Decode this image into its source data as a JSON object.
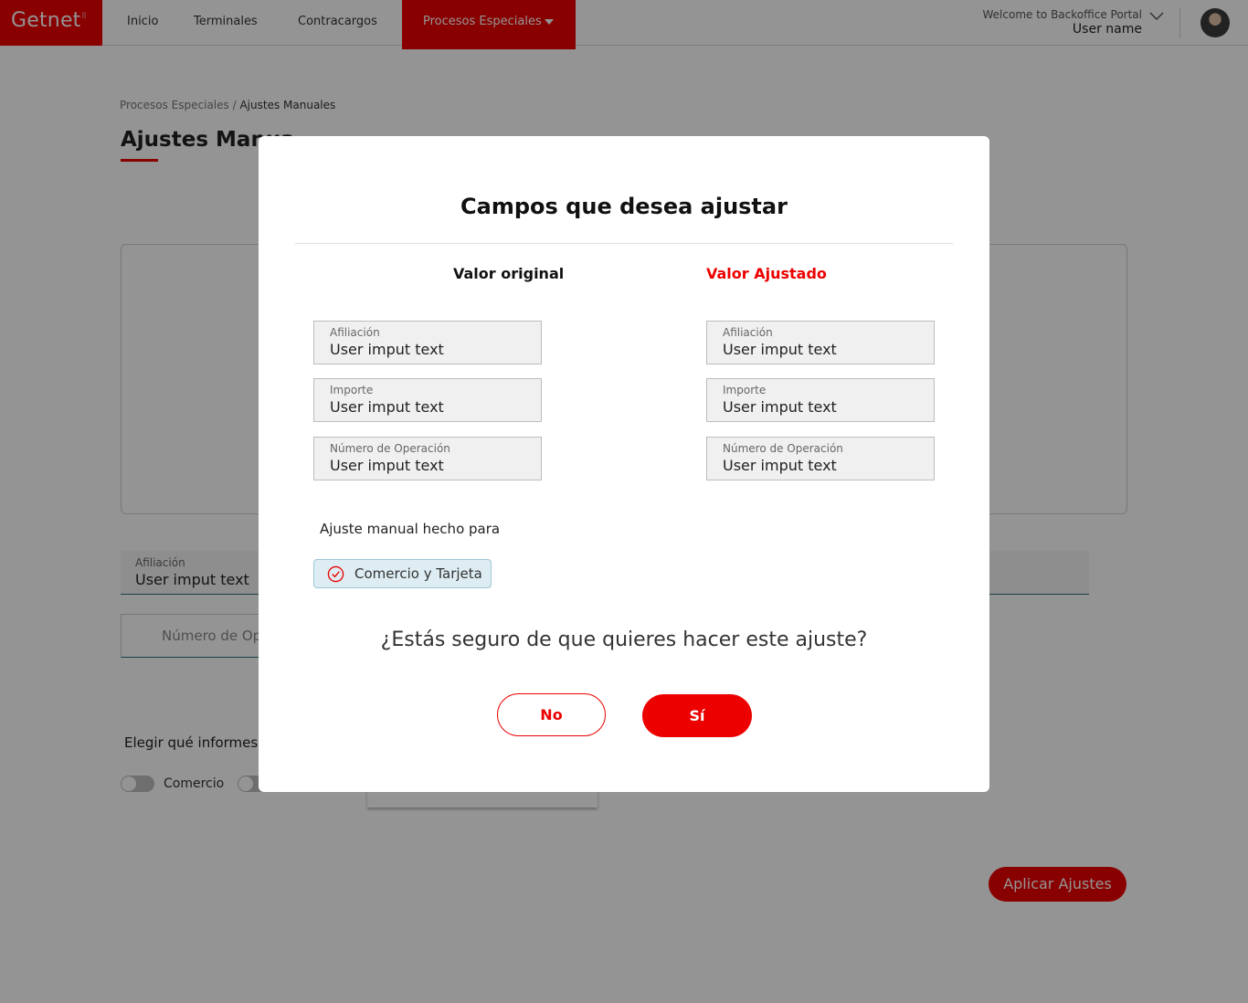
{
  "header": {
    "logo_text": "Getnet",
    "nav": {
      "inicio": "Inicio",
      "terminales": "Terminales",
      "contracargos": "Contracargos",
      "procesos": "Procesos Especiales"
    },
    "welcome": "Welcome to Backoffice Portal",
    "user_name": "User name"
  },
  "page": {
    "breadcrumb": {
      "parent": "Procesos Especiales",
      "separator": "/",
      "current": "Ajustes Manuales"
    },
    "title": "Ajustes Manua",
    "field_afiliacion": {
      "label": "Afiliación",
      "value": "User imput text"
    },
    "field_operacion_placeholder": "Número de Op",
    "elegir_label": "Elegir qué informes c",
    "toggle_comercio": "Comercio",
    "apply_button": "Aplicar Ajustes"
  },
  "modal": {
    "title": "Campos que desea ajustar",
    "original_header": "Valor original",
    "adjusted_header": "Valor Ajustado",
    "original_fields": [
      {
        "label": "Afiliación",
        "value": "User imput text"
      },
      {
        "label": "Importe",
        "value": "User imput text"
      },
      {
        "label": "Número de Operación",
        "value": "User imput text"
      }
    ],
    "adjusted_fields": [
      {
        "label": "Afiliación",
        "value": "User imput text"
      },
      {
        "label": "Importe",
        "value": "User imput text"
      },
      {
        "label": "Número de Operación",
        "value": "User imput text"
      }
    ],
    "made_for_label": "Ajuste manual hecho para",
    "made_for_chip": "Comercio y Tarjeta",
    "confirm_question": "¿Estás seguro de que quieres hacer este ajuste?",
    "no_button": "No",
    "yes_button": "Sí"
  },
  "colors": {
    "brand_red": "#ec0000",
    "chip_background": "#deedf3",
    "overlay": "rgba(0,0,0,0.42)"
  },
  "icons": [
    "chevron-down-icon",
    "caret-down-icon",
    "check-circle-icon"
  ]
}
